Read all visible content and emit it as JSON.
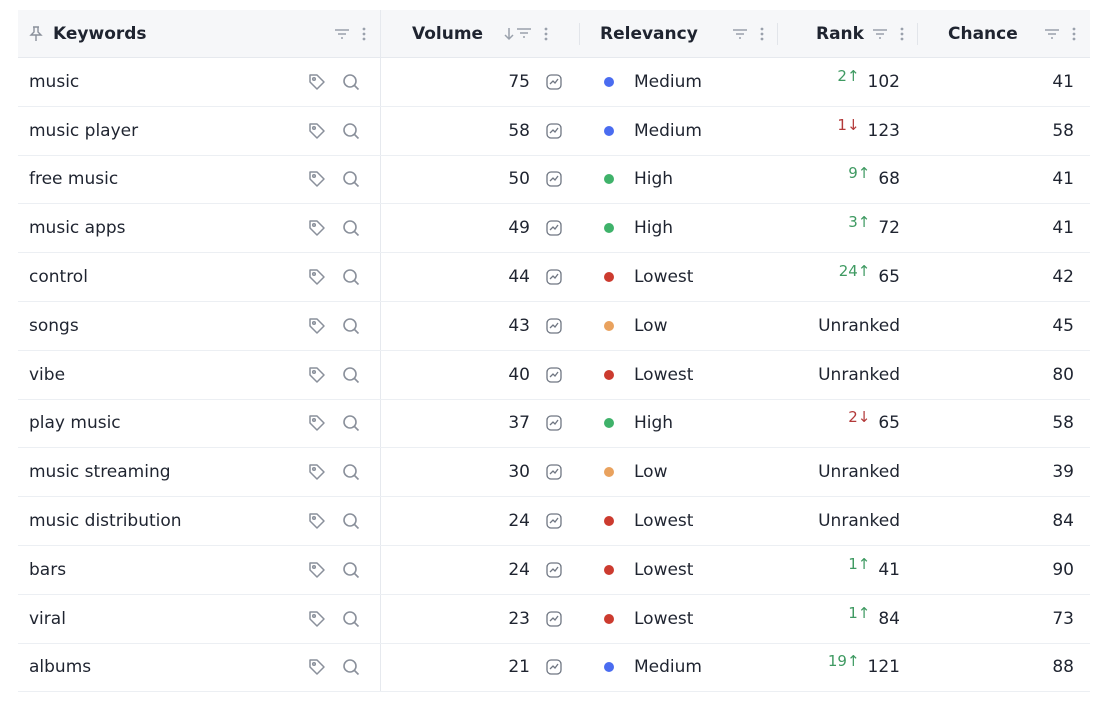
{
  "columns": {
    "keywords": "Keywords",
    "volume": "Volume",
    "relevancy": "Relevancy",
    "rank": "Rank",
    "chance": "Chance"
  },
  "relevancy_colors": {
    "Medium": "#4a6cf0",
    "High": "#3fb26a",
    "Lowest": "#cc3b2f",
    "Low": "#e9a25e"
  },
  "rows": [
    {
      "keyword": "music",
      "volume": "75",
      "relevancy": "Medium",
      "rank_change": "2",
      "rank_dir": "up",
      "rank": "102",
      "chance": "41"
    },
    {
      "keyword": "music player",
      "volume": "58",
      "relevancy": "Medium",
      "rank_change": "1",
      "rank_dir": "down",
      "rank": "123",
      "chance": "58"
    },
    {
      "keyword": "free music",
      "volume": "50",
      "relevancy": "High",
      "rank_change": "9",
      "rank_dir": "up",
      "rank": "68",
      "chance": "41"
    },
    {
      "keyword": "music apps",
      "volume": "49",
      "relevancy": "High",
      "rank_change": "3",
      "rank_dir": "up",
      "rank": "72",
      "chance": "41"
    },
    {
      "keyword": "control",
      "volume": "44",
      "relevancy": "Lowest",
      "rank_change": "24",
      "rank_dir": "up",
      "rank": "65",
      "chance": "42"
    },
    {
      "keyword": "songs",
      "volume": "43",
      "relevancy": "Low",
      "rank_change": "",
      "rank_dir": "",
      "rank": "Unranked",
      "chance": "45"
    },
    {
      "keyword": "vibe",
      "volume": "40",
      "relevancy": "Lowest",
      "rank_change": "",
      "rank_dir": "",
      "rank": "Unranked",
      "chance": "80"
    },
    {
      "keyword": "play music",
      "volume": "37",
      "relevancy": "High",
      "rank_change": "2",
      "rank_dir": "down",
      "rank": "65",
      "chance": "58"
    },
    {
      "keyword": "music streaming",
      "volume": "30",
      "relevancy": "Low",
      "rank_change": "",
      "rank_dir": "",
      "rank": "Unranked",
      "chance": "39"
    },
    {
      "keyword": "music distribution",
      "volume": "24",
      "relevancy": "Lowest",
      "rank_change": "",
      "rank_dir": "",
      "rank": "Unranked",
      "chance": "84"
    },
    {
      "keyword": "bars",
      "volume": "24",
      "relevancy": "Lowest",
      "rank_change": "1",
      "rank_dir": "up",
      "rank": "41",
      "chance": "90"
    },
    {
      "keyword": "viral",
      "volume": "23",
      "relevancy": "Lowest",
      "rank_change": "1",
      "rank_dir": "up",
      "rank": "84",
      "chance": "73"
    },
    {
      "keyword": "albums",
      "volume": "21",
      "relevancy": "Medium",
      "rank_change": "19",
      "rank_dir": "up",
      "rank": "121",
      "chance": "88"
    }
  ]
}
